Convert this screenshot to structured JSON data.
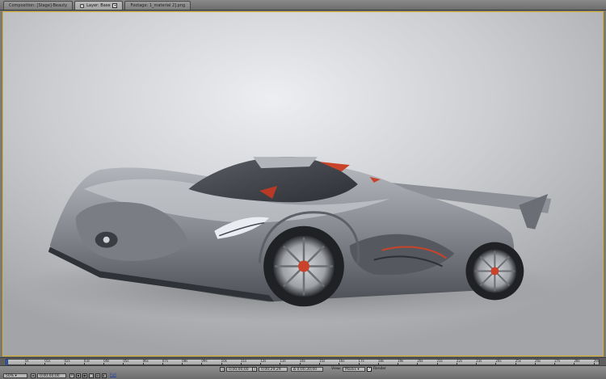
{
  "tabs": [
    {
      "label": "Composition: [Stage]-Beauty",
      "active": false
    },
    {
      "label": "Layer: Base",
      "active": true
    },
    {
      "label": "Footage: 1_material 2].png",
      "active": false
    }
  ],
  "timeline": {
    "ticks": [
      "0s",
      "01s",
      "02s",
      "03s",
      "04s",
      "05s",
      "06s",
      "07s",
      "08s",
      "09s",
      "10s",
      "11s",
      "12s",
      "13s",
      "14s",
      "15s",
      "16s",
      "17s",
      "18s",
      "19s",
      "20s",
      "21s",
      "22s",
      "23s",
      "24s",
      "25s",
      "26s",
      "27s",
      "28s",
      "29s"
    ]
  },
  "status": {
    "start_time": "0;00;00;00",
    "end_time": "0;00;29;29",
    "duration": "Δ 0;00;30;00",
    "view_label": "View:",
    "view_value": "Masks",
    "render_label": "Render",
    "render_checked": true,
    "zoom": "50%",
    "timecode": "0;00;00;00",
    "resolution": "Full"
  },
  "colors": {
    "viewer_border": "#d8b02a",
    "accent_red": "#c9422a",
    "cti_blue": "#3b6fd0"
  }
}
